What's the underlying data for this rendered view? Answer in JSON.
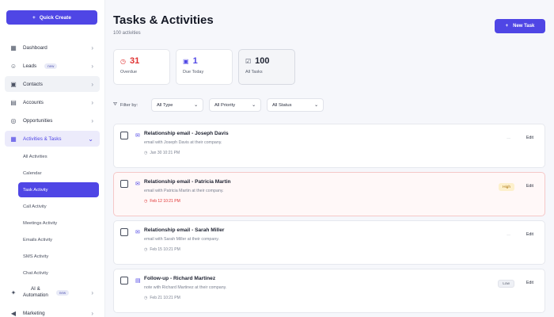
{
  "sidebar": {
    "quick_create": "Quick Create",
    "items": [
      {
        "label": "Dashboard",
        "icon": "grid-icon"
      },
      {
        "label": "Leads",
        "badge": "new",
        "icon": "user-icon"
      },
      {
        "label": "Contacts",
        "icon": "contacts-icon"
      },
      {
        "label": "Accounts",
        "icon": "briefcase-icon"
      },
      {
        "label": "Opportunities",
        "icon": "target-icon"
      },
      {
        "label": "Activities & Tasks",
        "icon": "calendar-icon"
      }
    ],
    "sub_items": [
      "All Activities",
      "Calendar",
      "Task Activity",
      "Call Activity",
      "Meetings Activity",
      "Emails Activity",
      "SMS Activity",
      "Chat Activity"
    ],
    "ai": {
      "line1": "AI &",
      "line2": "Automation",
      "badge": "new"
    },
    "marketing": "Marketing"
  },
  "header": {
    "title": "Tasks & Activities",
    "subtitle": "100 activities",
    "new_task": "New Task"
  },
  "stats": [
    {
      "value": "31",
      "label": "Overdue",
      "color": "#e03131"
    },
    {
      "value": "1",
      "label": "Due Today",
      "color": "#4f46e5"
    },
    {
      "value": "100",
      "label": "All Tasks",
      "color": "#1f2433"
    }
  ],
  "filters": {
    "label": "Filter by:",
    "type": "All Type",
    "priority": "All Priority",
    "status": "All Status"
  },
  "tasks": [
    {
      "title": "Relationship email - Joseph Davis",
      "desc": "email with Joseph Davis at their company.",
      "date": "Jan 30 10:21 PM",
      "priority": "—",
      "edit": "Edit"
    },
    {
      "title": "Relationship email - Patricia Martin",
      "desc": "email with Patricia Martin at their company.",
      "date": "Feb 12 10:21 PM",
      "priority": "High",
      "edit": "Edit"
    },
    {
      "title": "Relationship email - Sarah Miller",
      "desc": "email with Sarah Miller at their company.",
      "date": "Feb 15 10:21 PM",
      "priority": "—",
      "edit": "Edit"
    },
    {
      "title": "Follow-up - Richard Martinez",
      "desc": "note with Richard Martinez at their company.",
      "date": "Feb 21 10:21 PM",
      "priority": "Low",
      "edit": "Edit"
    }
  ],
  "colors": {
    "accent": "#4f46e5",
    "danger": "#e03131"
  }
}
